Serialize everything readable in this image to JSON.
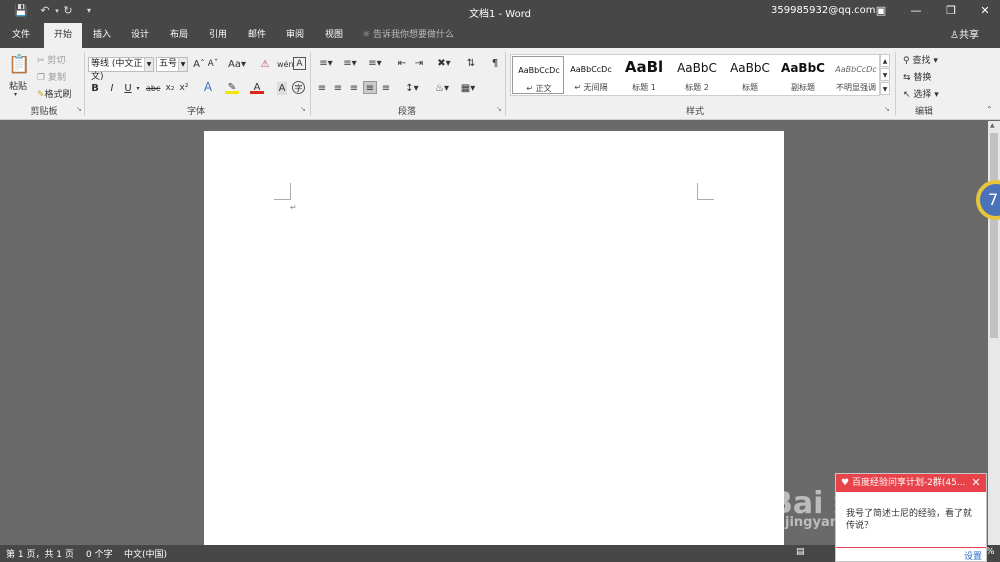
{
  "window": {
    "title": "文档1 - Word",
    "account": "359985932@qq.com"
  },
  "tabs": [
    {
      "label": "文件"
    },
    {
      "label": "开始"
    },
    {
      "label": "插入"
    },
    {
      "label": "设计"
    },
    {
      "label": "布局"
    },
    {
      "label": "引用"
    },
    {
      "label": "邮件"
    },
    {
      "label": "审阅"
    },
    {
      "label": "视图"
    }
  ],
  "tell_me": "告诉我你想要做什么",
  "share": "共享",
  "clipboard": {
    "paste": "粘贴",
    "cut": "剪切",
    "copy": "复制",
    "format_painter": "格式刷",
    "group_label": "剪贴板"
  },
  "font": {
    "font_name": "等线 (中文正文)",
    "font_size": "五号",
    "case_btn": "Aa",
    "group_label": "字体"
  },
  "paragraph": {
    "group_label": "段落"
  },
  "styles": {
    "items": [
      {
        "preview": "AaBbCcDc",
        "name": "正文"
      },
      {
        "preview": "AaBbCcDc",
        "name": "无间隔"
      },
      {
        "preview": "AaBl",
        "name": "标题 1"
      },
      {
        "preview": "AaBbC",
        "name": "标题 2"
      },
      {
        "preview": "AaBbC",
        "name": "标题"
      },
      {
        "preview": "AaBbC",
        "name": "副标题"
      },
      {
        "preview": "AaBbCcDc",
        "name": "不明显强调"
      }
    ],
    "group_label": "样式"
  },
  "editing": {
    "find": "查找",
    "replace": "替换",
    "select": "选择",
    "group_label": "编辑"
  },
  "status": {
    "page": "第 1 页，共 1 页",
    "words": "0 个字",
    "language": "中文(中国)",
    "zoom_tail": "%"
  },
  "popup": {
    "header": "百度经验问享计划-2群(45...",
    "message": "我号了简述士尼的经验，看了就传说？",
    "settings": "设置"
  },
  "badge": {
    "value": "7"
  },
  "watermark": {
    "brand": "Bai 经验",
    "url": "jingyan.baidu.com"
  },
  "colors": {
    "titlebar": "#474747",
    "ribbon": "#f0f0f0",
    "popup_header": "#e8434a"
  }
}
